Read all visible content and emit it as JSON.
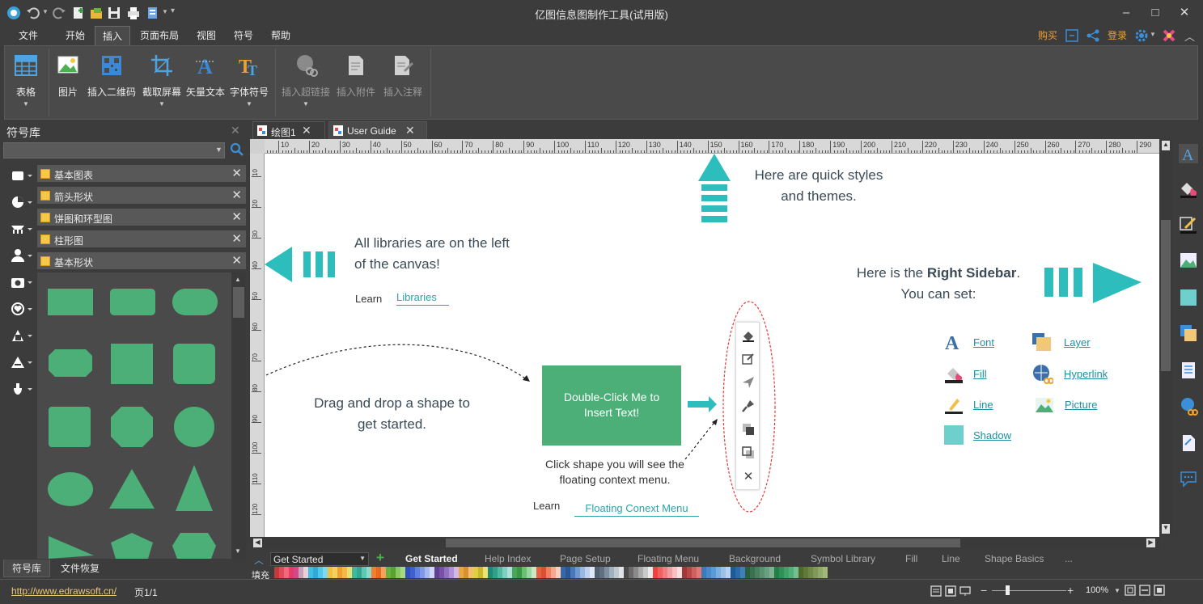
{
  "app": {
    "title": "亿图信息图制作工具(试用版)"
  },
  "menu": {
    "file": "文件",
    "start": "开始",
    "insert": "插入",
    "page_layout": "页面布局",
    "view": "视图",
    "symbol": "符号",
    "help": "帮助",
    "buy": "购买",
    "login": "登录"
  },
  "ribbon": {
    "table": "表格",
    "image": "图片",
    "qrcode": "插入二维码",
    "screenshot": "截取屏幕",
    "vector_text": "矢量文本",
    "font_symbol": "字体符号",
    "hyperlink": "插入超链接",
    "attachment": "插入附件",
    "note": "插入注释"
  },
  "library": {
    "title": "符号库",
    "search_placeholder": "",
    "categories": [
      "基本图表",
      "箭头形状",
      "饼图和环型图",
      "柱形图",
      "基本形状"
    ]
  },
  "left_tabs": {
    "library": "符号库",
    "recovery": "文件恢复"
  },
  "doc_tabs": [
    "绘图1",
    "User Guide"
  ],
  "ruler": {
    "h_ticks": [
      "10",
      "20",
      "30",
      "40",
      "50",
      "60",
      "70",
      "80",
      "90",
      "100",
      "110",
      "120",
      "130",
      "140",
      "150",
      "160",
      "170",
      "180",
      "190",
      "200",
      "210",
      "220",
      "230",
      "240",
      "250",
      "260",
      "270",
      "280",
      "290"
    ],
    "v_ticks": [
      "10",
      "20",
      "30",
      "40",
      "50",
      "60",
      "70",
      "80",
      "90",
      "100",
      "110",
      "120"
    ]
  },
  "canvas": {
    "quick_styles_1": "Here are quick styles",
    "quick_styles_2": "and themes.",
    "libs_1": "All libraries are on the left",
    "libs_2": "of the canvas!",
    "learn": "Learn",
    "libraries_link": "Libraries",
    "right_sidebar_pre": "Here is the ",
    "right_sidebar_bold": "Right Sidebar",
    "right_sidebar_post": ".",
    "you_can_set": "You can set:",
    "drag_1": "Drag and drop a shape to",
    "drag_2": "get started.",
    "shape_text_1": "Double-Click Me to",
    "shape_text_2": "Insert Text!",
    "click_1": "Click shape you will see the",
    "click_2": "floating context menu.",
    "floating_link": "Floating Conext Menu",
    "sidebar_links": {
      "font": "Font",
      "layer": "Layer",
      "fill": "Fill",
      "hyperlink": "Hyperlink",
      "line": "Line",
      "picture": "Picture",
      "shadow": "Shadow"
    }
  },
  "page_tabs": {
    "current_page": "Get Started",
    "tabs": [
      "Get Started",
      "Help Index",
      "Page Setup",
      "Floating Menu",
      "Background",
      "Symbol Library",
      "Fill",
      "Line",
      "Shape Basics",
      "..."
    ]
  },
  "fill_label": "填充",
  "status": {
    "url": "http://www.edrawsoft.cn/",
    "page": "页1/1",
    "zoom": "100%"
  },
  "colors": {
    "accent": "#2ebdbd",
    "shape_green": "#4caf77",
    "link": "#1e8fa0",
    "brand_orange": "#f0a030"
  }
}
